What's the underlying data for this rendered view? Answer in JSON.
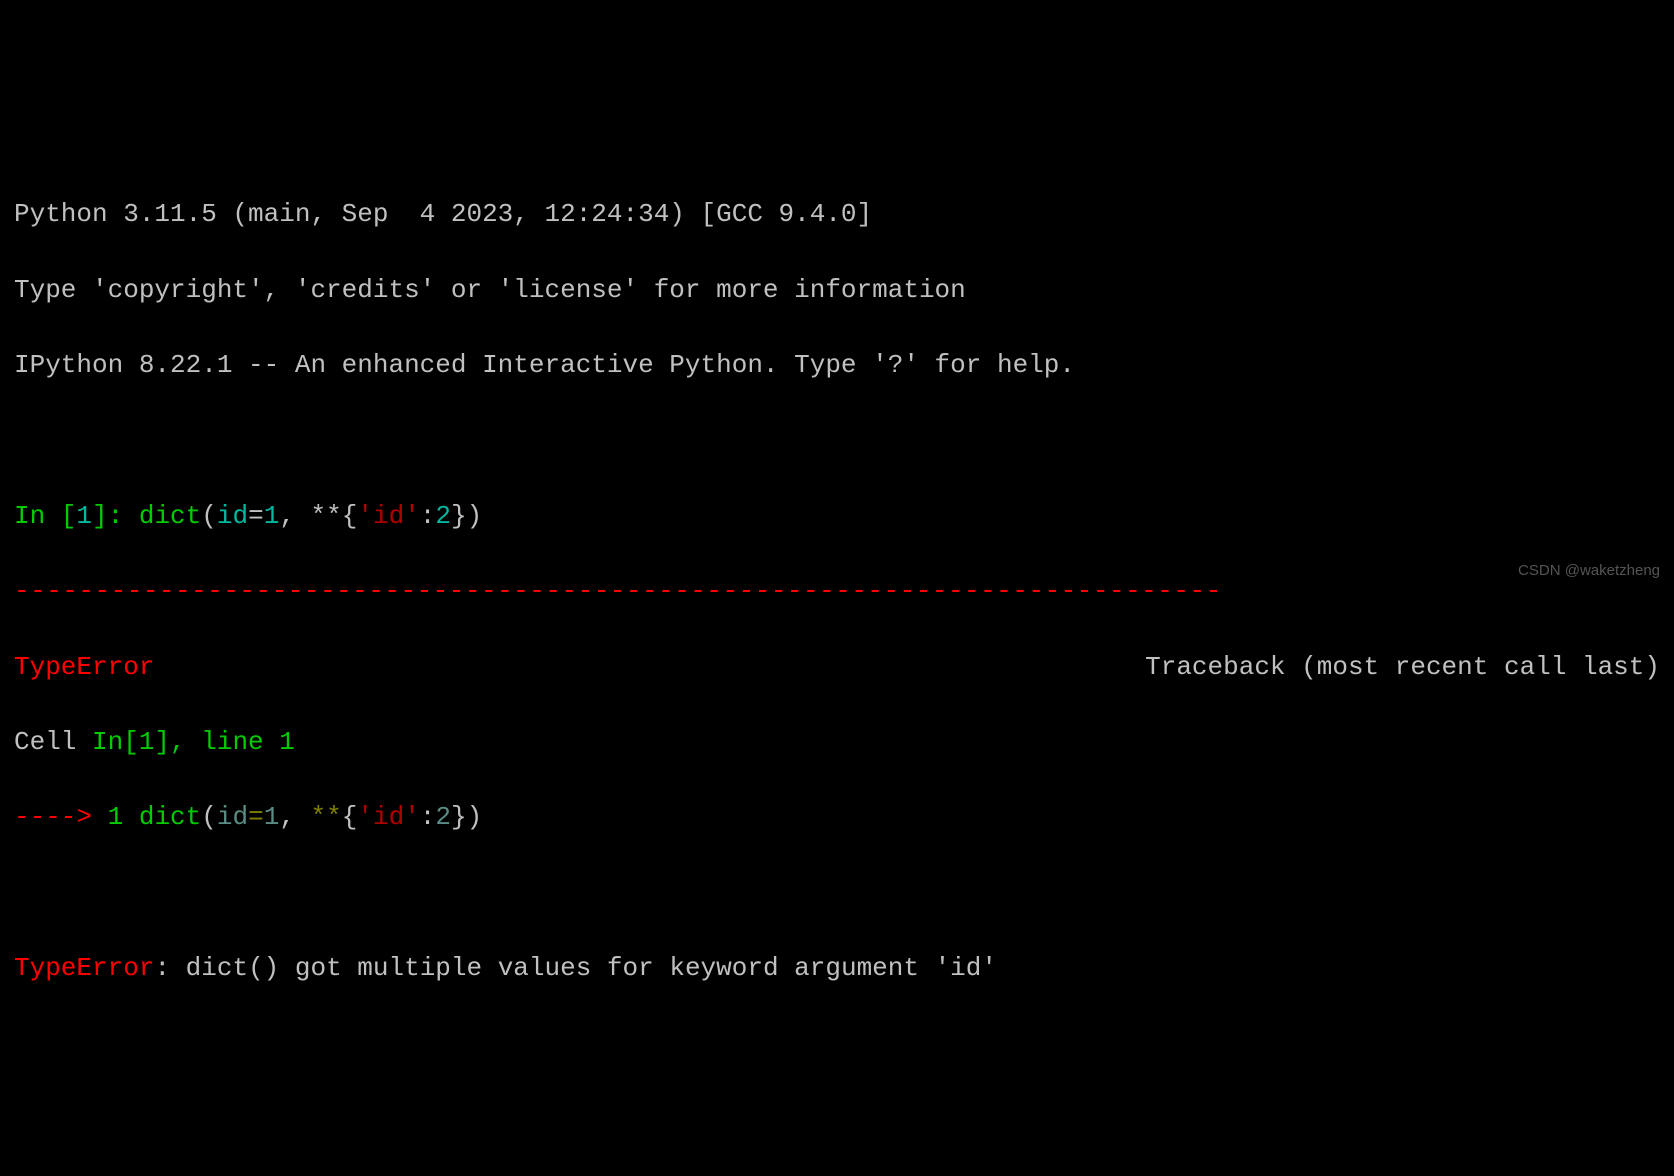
{
  "header": {
    "python_version_line": "Python 3.11.5 (main, Sep  4 2023, 12:24:34) [GCC 9.4.0]",
    "copyright_line": "Type 'copyright', 'credits' or 'license' for more information",
    "ipython_line": "IPython 8.22.1 -- An enhanced Interactive Python. Type '?' for help."
  },
  "input": {
    "prompt_in": "In [",
    "prompt_num": "1",
    "prompt_close": "]: ",
    "tokens": {
      "dict": "dict",
      "open_paren": "(",
      "id_kw": "id",
      "eq": "=",
      "one": "1",
      "comma_sp": ", ",
      "star_star": "**",
      "brace_open": "{",
      "q_id_q": "'id'",
      "colon": ":",
      "two": "2",
      "brace_close": "}",
      "close_paren": ")"
    }
  },
  "separator": "---------------------------------------------------------------------------",
  "traceback": {
    "error_type": "TypeError",
    "tb_label": "Traceback (most recent call last)",
    "cell_prefix": "Cell ",
    "cell_in": "In[1]",
    "cell_suffix": ", line 1",
    "arrow": "----> ",
    "arrow_num": "1",
    "arrow_sp": " ",
    "code": {
      "dict": "dict",
      "open_paren": "(",
      "id_kw": "id",
      "eq": "=",
      "one": "1",
      "comma_sp": ", ",
      "star_star": "**",
      "brace_open": "{",
      "q_id_q": "'id'",
      "colon": ":",
      "two": "2",
      "brace_close": "}",
      "close_paren": ")"
    }
  },
  "error": {
    "type": "TypeError",
    "colon": ": ",
    "message": "dict() got multiple values for keyword argument 'id'"
  },
  "watermark": "CSDN @waketzheng"
}
